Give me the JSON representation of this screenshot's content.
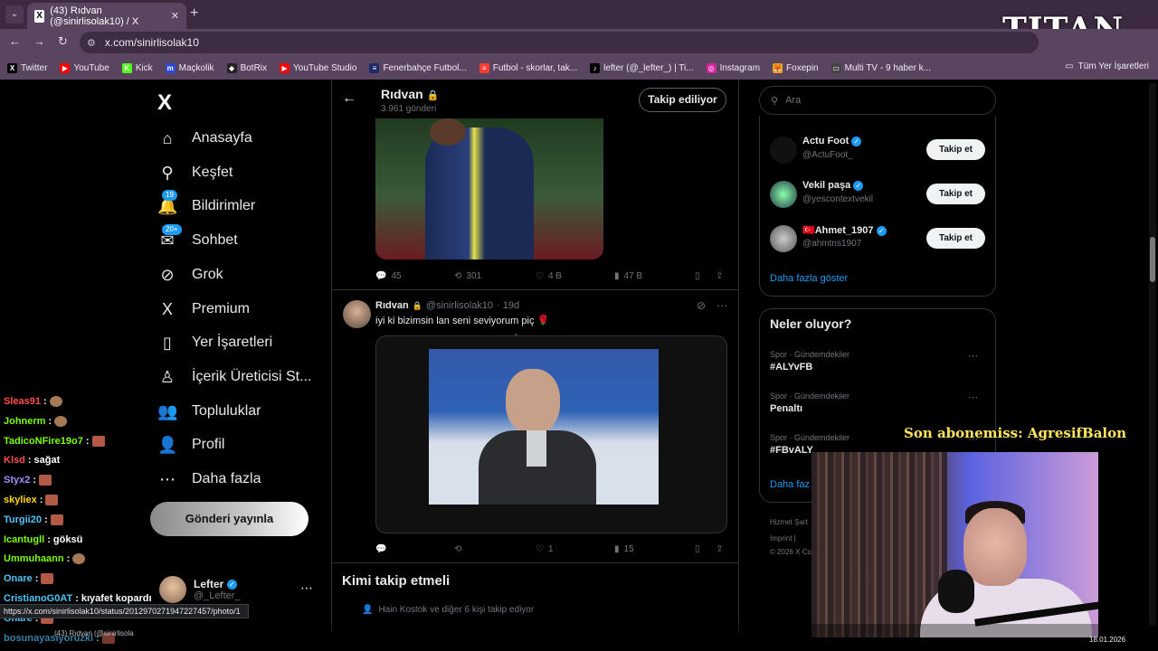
{
  "browser": {
    "tab_title": "(43) Rıdvan (@sinirlisolak10) / X",
    "url": "x.com/sinirlisolak10",
    "bookmarks": [
      {
        "label": "Twitter",
        "color": "#000000",
        "glyph": "X"
      },
      {
        "label": "YouTube",
        "color": "#ff0000",
        "glyph": "▶"
      },
      {
        "label": "Kick",
        "color": "#53fc18",
        "glyph": "K"
      },
      {
        "label": "Maçkolik",
        "color": "#2b4bd8",
        "glyph": "m"
      },
      {
        "label": "BotRix",
        "color": "#222222",
        "glyph": "◆"
      },
      {
        "label": "YouTube Studio",
        "color": "#ff0000",
        "glyph": "▶"
      },
      {
        "label": "Fenerbahçe Futbol...",
        "color": "#1e2a6a",
        "glyph": "≡"
      },
      {
        "label": "Futbol - skorlar, tak...",
        "color": "#ff3b30",
        "glyph": "≡"
      },
      {
        "label": "lefter (@_lefter_) | Ti...",
        "color": "#000000",
        "glyph": "♪"
      },
      {
        "label": "Instagram",
        "color": "#d6249f",
        "glyph": "◎"
      },
      {
        "label": "Foxepin",
        "color": "#e8a317",
        "glyph": "🦊"
      },
      {
        "label": "Multi TV - 9 haber k...",
        "color": "#444444",
        "glyph": "▭"
      }
    ],
    "all_bookmarks": "Tüm Yer İşaretleri",
    "status_url": "https://x.com/sinirlisolak10/status/2012970271947227457/photo/1",
    "taskbar_item": "(43) Rıdvan (@sinirlisola",
    "date": "18.01.2026"
  },
  "overlay": {
    "logo": "TITAN",
    "subscriber_banner": "Son abonemiss: AgresifBalon"
  },
  "sidebar": {
    "items": [
      {
        "label": "Anasayfa",
        "icon": "⌂",
        "badge": ""
      },
      {
        "label": "Keşfet",
        "icon": "⚲",
        "badge": ""
      },
      {
        "label": "Bildirimler",
        "icon": "🔔",
        "badge": "19"
      },
      {
        "label": "Sohbet",
        "icon": "✉",
        "badge": "20+"
      },
      {
        "label": "Grok",
        "icon": "⊘",
        "badge": ""
      },
      {
        "label": "Premium",
        "icon": "X",
        "badge": ""
      },
      {
        "label": "Yer İşaretleri",
        "icon": "▯",
        "badge": ""
      },
      {
        "label": "İçerik Üreticisi St...",
        "icon": "♙",
        "badge": ""
      },
      {
        "label": "Topluluklar",
        "icon": "👥",
        "badge": ""
      },
      {
        "label": "Profil",
        "icon": "👤",
        "badge": ""
      },
      {
        "label": "Daha fazla",
        "icon": "⋯",
        "badge": ""
      }
    ],
    "post_button": "Gönderi yayınla",
    "account_name": "Lefter",
    "account_handle": "@_Lefter_"
  },
  "profile_header": {
    "name": "Rıdvan",
    "post_count": "3.961 gönderi",
    "following_button": "Takip ediliyor"
  },
  "tweet1_actions": {
    "replies": "45",
    "reposts": "301",
    "likes": "4 B",
    "views": "47 B"
  },
  "tweet2": {
    "name": "Rıdvan",
    "handle": "@sinirlisolak10",
    "time": "· 19d",
    "text": "iyi ki bizimsin lan seni seviyorum piç 🌹",
    "replies": "",
    "reposts": "",
    "likes": "1",
    "views": "15"
  },
  "who_to_follow": {
    "title": "Kimi takip etmeli",
    "subtitle": "Hain Kostok ve diğer 6 kişi takip ediyor"
  },
  "right": {
    "search_placeholder": "Ara",
    "suggestions": [
      {
        "name": "Actu Foot",
        "handle": "@ActuFoot_",
        "button": "Takip et"
      },
      {
        "name": "Vekil paşa",
        "handle": "@yescontextvekil",
        "button": "Takip et"
      },
      {
        "name": "🇹🇷Ahmet_1907",
        "handle": "@ahmtns1907",
        "button": "Takip et"
      }
    ],
    "show_more": "Daha fazla göster",
    "trends_title": "Neler oluyor?",
    "trends": [
      {
        "category": "Spor · Gündemdekiler",
        "topic": "#ALYvFB"
      },
      {
        "category": "Spor · Gündemdekiler",
        "topic": "Penaltı"
      },
      {
        "category": "Spor · Gündemdekiler",
        "topic": "#FBvALY"
      }
    ],
    "show_more_2": "Daha faz",
    "footer_1": "Hizmet Şart",
    "footer_2": "Imprint |",
    "footer_3": "© 2026 X Co"
  },
  "chat": [
    {
      "user": "Sleas91",
      "color": "#ff4d4d",
      "message": "",
      "emote": "round"
    },
    {
      "user": "Johnerm",
      "color": "#7cfc00",
      "message": "",
      "emote": "round"
    },
    {
      "user": "TadicoNFire19o7",
      "color": "#7cfc00",
      "message": "",
      "emote": "box"
    },
    {
      "user": "Klsd",
      "color": "#ff4d4d",
      "message": "sağat",
      "emote": ""
    },
    {
      "user": "Styx2",
      "color": "#a78bfa",
      "message": "",
      "emote": "box"
    },
    {
      "user": "skyliex",
      "color": "#ffd700",
      "message": "",
      "emote": "box"
    },
    {
      "user": "Turgii20",
      "color": "#4fc3f7",
      "message": "",
      "emote": "box"
    },
    {
      "user": "Icantugll",
      "color": "#7cfc00",
      "message": "göksü",
      "emote": ""
    },
    {
      "user": "Ummuhaann",
      "color": "#7cfc00",
      "message": "",
      "emote": "round"
    },
    {
      "user": "Onare",
      "color": "#4fc3f7",
      "message": "",
      "emote": "box"
    },
    {
      "user": "CristianoG0AT",
      "color": "#4fc3f7",
      "message": "kıyafet kopardı",
      "emote": ""
    },
    {
      "user": "Onare",
      "color": "#4fc3f7",
      "message": "",
      "emote": "box"
    },
    {
      "user": "bosunayasiyoruzki",
      "color": "#4fc3f7",
      "message": "",
      "emote": "box"
    }
  ]
}
